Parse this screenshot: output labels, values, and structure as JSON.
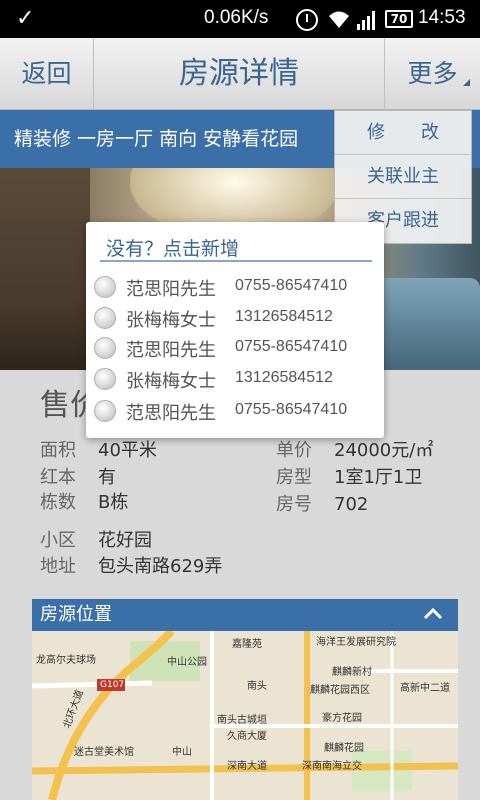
{
  "status_bar": {
    "speed": "0.06K/s",
    "battery": "70",
    "time": "14:53"
  },
  "header": {
    "back_label": "返回",
    "title": "房源详情",
    "more_label": "更多"
  },
  "tags": "精装修  一房一厅  南向  安静看花园",
  "more_menu": {
    "items": [
      {
        "label": "修　　改"
      },
      {
        "label": "关联业主"
      },
      {
        "label": "客户跟进"
      }
    ]
  },
  "picker": {
    "add_new": "没有？点击新增",
    "contacts": [
      {
        "name": "范思阳先生",
        "phone": "0755-86547410"
      },
      {
        "name": "张梅梅女士",
        "phone": "13126584512"
      },
      {
        "name": "范思阳先生",
        "phone": "0755-86547410"
      },
      {
        "name": "张梅梅女士",
        "phone": "13126584512"
      },
      {
        "name": "范思阳先生",
        "phone": "0755-86547410"
      }
    ]
  },
  "info": {
    "price_label": "售价",
    "area": {
      "k": "面积",
      "v": "40平米"
    },
    "red_book": {
      "k": "红本",
      "v": "有"
    },
    "building": {
      "k": "栋数",
      "v": "B栋"
    },
    "unit_price": {
      "k": "单价",
      "v": "24000元/㎡"
    },
    "layout": {
      "k": "房型",
      "v": "1室1厅1卫"
    },
    "room_no": {
      "k": "房号",
      "v": "702"
    },
    "community": {
      "k": "小区",
      "v": "花好园"
    },
    "address": {
      "k": "地址",
      "v": "包头南路629弄"
    }
  },
  "location": {
    "title": "房源位置",
    "map_labels": [
      "龙高尔夫球场",
      "G107",
      "中山公园",
      "嘉隆苑",
      "海洋王发展研究院",
      "麒麟新村",
      "南头",
      "麒麟花园西区",
      "高新中二道",
      "南头古城垣",
      "豪方花园",
      "久商大厦",
      "迷古堂美术馆",
      "中山",
      "麒麟花园",
      "深南大道",
      "深南南海立交",
      "北环大道"
    ]
  }
}
